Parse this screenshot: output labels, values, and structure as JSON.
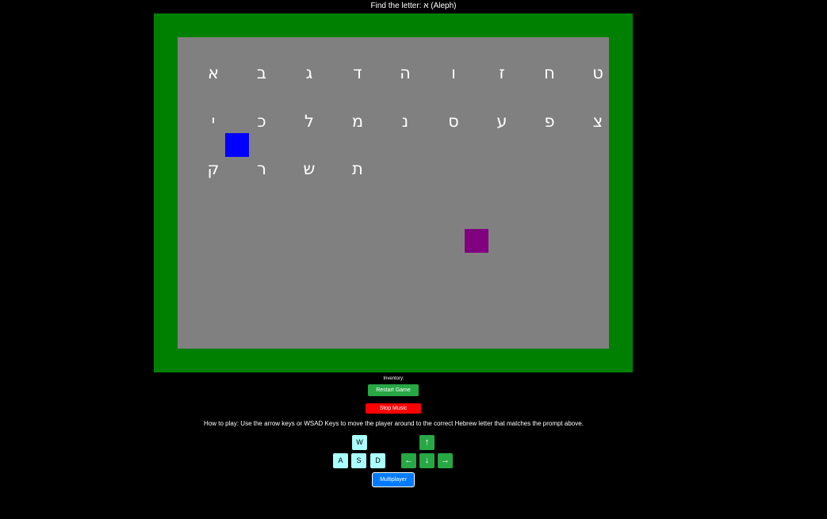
{
  "prompt": "Find the letter: א (Aleph)",
  "letters_row1": [
    "א",
    "ב",
    "ג",
    "ד",
    "ה",
    "ו",
    "ז",
    "ח",
    "ט"
  ],
  "letters_row2": [
    "י",
    "כ",
    "ל",
    "מ",
    "נ",
    "ס",
    "ע",
    "פ",
    "צ"
  ],
  "letters_row3": [
    "ק",
    "ר",
    "ש",
    "ת"
  ],
  "inventory_label": "Inventory:",
  "buttons": {
    "restart": "Restart Game",
    "stop_music": "Stop Music",
    "multiplayer": "Multiplayer"
  },
  "how_to_play": "How to play: Use the arrow keys or WSAD Keys to move the player around to the correct Hebrew letter that matches the prompt above.",
  "keys": {
    "w": "W",
    "a": "A",
    "s": "S",
    "d": "D",
    "up": "↑",
    "left": "←",
    "down": "↓",
    "right": "→"
  },
  "colors": {
    "board_border": "#008000",
    "arena": "#808080",
    "player": "#0000ff",
    "opponent": "#800080",
    "restart_button": "#28a745",
    "stop_music_button": "#ff0000",
    "wsad_key": "#aaffff",
    "arrow_key": "#28a745",
    "multiplayer_button": "#007bff"
  }
}
